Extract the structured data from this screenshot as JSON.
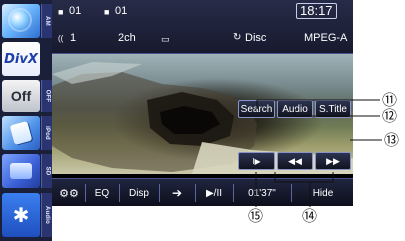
{
  "left_column": {
    "tabs": {
      "am": "AM",
      "off": "OFF",
      "ipod": "iPod",
      "sd": "SD",
      "audio": "Audio"
    },
    "tile_divx": "DivX",
    "tile_off": "Off",
    "bluetooth_icon": "bluetooth-icon"
  },
  "status_bar": {
    "folder_number": "01",
    "file_number": "01",
    "clock": "18:17",
    "audio_stream_number": "1",
    "channels": "2ch",
    "repeat_mode": "Disc",
    "audio_format": "MPEG-A"
  },
  "video_buttons": {
    "search": "Search",
    "audio": "Audio",
    "subtitle": "S.Title"
  },
  "control_bar": {
    "eq": "EQ",
    "disp": "Disp",
    "play_pause": "▶/II",
    "elapsed_time": "01'37\"",
    "hide": "Hide"
  },
  "callouts": {
    "n11": "⑪",
    "n12": "⑫",
    "n13": "⑬",
    "n14": "⑭",
    "n15": "⑮"
  },
  "colors": {
    "screen_dark": "#171a2e",
    "accent_border": "#8a93c8",
    "source_blue": "#1d3fa8"
  }
}
